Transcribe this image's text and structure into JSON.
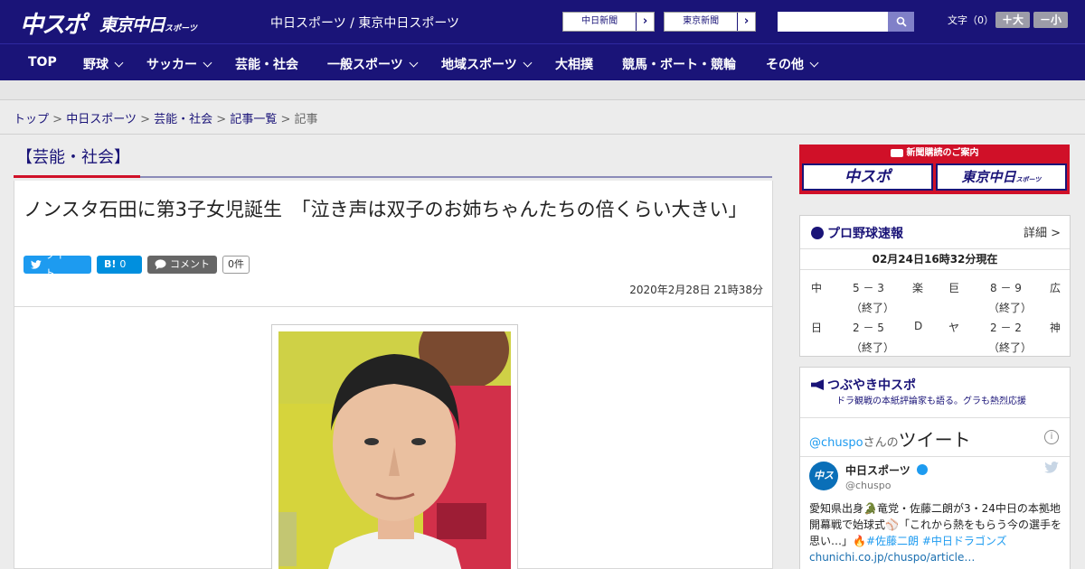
{
  "header": {
    "logo_chuspo": "中スポ",
    "logo_tokyo": "東京中日",
    "logo_tokyo_small": "スポーツ",
    "site_names": "中日スポーツ / 東京中日スポーツ",
    "ext_link_1": "中日新聞",
    "ext_link_2": "東京新聞",
    "search_placeholder": "",
    "fontsize_label": "文字（0）",
    "fontsize_up": "＋大",
    "fontsize_down": "－小"
  },
  "nav": {
    "items": [
      {
        "label": "TOP",
        "dropdown": false
      },
      {
        "label": "野球",
        "dropdown": true
      },
      {
        "label": "サッカー",
        "dropdown": true
      },
      {
        "label": "芸能・社会",
        "dropdown": false
      },
      {
        "label": "一般スポーツ",
        "dropdown": true
      },
      {
        "label": "地域スポーツ",
        "dropdown": true
      },
      {
        "label": "大相撲",
        "dropdown": false
      },
      {
        "label": "競馬・ボート・競輪",
        "dropdown": false
      },
      {
        "label": "その他",
        "dropdown": true
      }
    ]
  },
  "breadcrumb": {
    "items": [
      "トップ",
      "中日スポーツ",
      "芸能・社会",
      "記事一覧"
    ],
    "current": "記事",
    "separator": ">"
  },
  "article": {
    "category": "【芸能・社会】",
    "title": "ノンスタ石田に第3子女児誕生　「泣き声は双子のお姉ちゃんたちの倍くらい大きい」",
    "share": {
      "tweet": "ツイート",
      "hatena_icon": "B!",
      "hatena_count": "0",
      "comment": "コメント",
      "comment_count": "0件"
    },
    "date": "2020年2月28日 21時38分"
  },
  "sidebar": {
    "subscription": {
      "title": "新聞購読のご案内",
      "logo_1": "中スポ",
      "logo_2": "東京中日",
      "logo_2_small": "スポーツ"
    },
    "baseball": {
      "title": "プロ野球速報",
      "detail": "詳細 >",
      "timestamp": "02月24日16時32分現在",
      "games": [
        {
          "home": "中",
          "score": "5 － 3",
          "away": "楽",
          "status": "（終了）"
        },
        {
          "home": "巨",
          "score": "8 － 9",
          "away": "広",
          "status": "（終了）"
        },
        {
          "home": "日",
          "score": "2 － 5",
          "away": "D",
          "status": "（終了）"
        },
        {
          "home": "ヤ",
          "score": "2 － 2",
          "away": "神",
          "status": "（終了）"
        }
      ]
    },
    "twitter": {
      "title": "つぶやき中スポ",
      "subtitle": "ドラ観戦の本紙評論家も語る。グラも熱烈応援",
      "handle_prefix": "@chuspo",
      "handle_suffix": "さんの",
      "handle_label": "ツイート",
      "account_name": "中日スポーツ",
      "account_handle": "@chuspo",
      "avatar_text": "中スポ",
      "tweet_text_1": "愛知県出身",
      "tweet_text_2": "竜党・佐藤二朗が3・24中日の本拠地開幕戦で始球式",
      "tweet_text_3": "「これから熱をもらう今の選手を思い…」",
      "hashtag_1": "#佐藤二朗",
      "hashtag_2": "#中日ドラゴンズ",
      "tweet_link": "chunichi.co.jp/chuspo/article…"
    }
  },
  "colors": {
    "brand_navy": "#1a1478",
    "accent_red": "#d01028",
    "link": "#1a1478",
    "tweet_blue": "#1d9bf0",
    "hatena_blue": "#008fde"
  }
}
